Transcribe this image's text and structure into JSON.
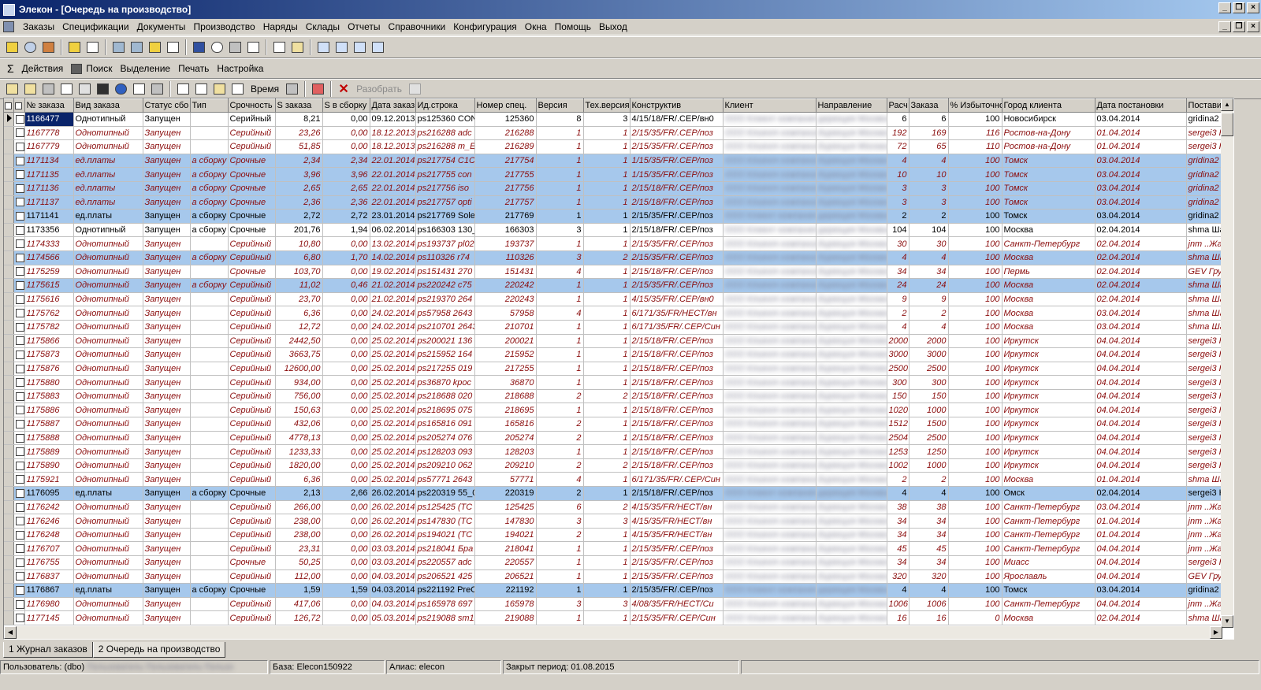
{
  "window": {
    "title": "Элекон - [Очередь на производство]"
  },
  "menu": [
    "Заказы",
    "Спецификации",
    "Документы",
    "Производство",
    "Наряды",
    "Склады",
    "Отчеты",
    "Справочники",
    "Конфигурация",
    "Окна",
    "Помощь",
    "Выход"
  ],
  "toolbar2": {
    "sigma": "Σ",
    "actions": "Действия",
    "search": "Поиск",
    "selection": "Выделение",
    "print": "Печать",
    "settings": "Настройка"
  },
  "toolbar3": {
    "time": "Время",
    "disassemble": "Разобрать"
  },
  "columns": [
    "№ заказа",
    "Вид заказа",
    "Статус сбо",
    "Тип",
    "Срочность",
    "S заказа",
    "S в сборку",
    "Дата заказ",
    "Ид.строка",
    "Номер спец.",
    "Версия",
    "Тех.версия",
    "Конструктив",
    "Клиент",
    "Направление",
    "Расч",
    "Заказа",
    "% Избыточно",
    "Город клиента",
    "Дата постановки",
    "Постави"
  ],
  "rows": [
    {
      "s": "cur",
      "c": [
        "1166477",
        "Однотипный",
        "Запущен",
        "",
        "Серийный",
        "8,21",
        "0,00",
        "09.12.2013",
        "ps125360 CON",
        "125360",
        "8",
        "3",
        "4/15/18/FR/.CEP/вн0",
        "",
        "",
        "6",
        "6",
        "100",
        "Новосибирск",
        "03.04.2014",
        "gridina2 I"
      ]
    },
    {
      "s": "it",
      "c": [
        "1167778",
        "Однотипный",
        "Запущен",
        "",
        "Серийный",
        "23,26",
        "0,00",
        "18.12.2013",
        "ps216288 adc",
        "216288",
        "1",
        "1",
        "2/15/35/FR/.CEP/поз",
        "",
        "",
        "192",
        "169",
        "116",
        "Ростов-на-Дону",
        "01.04.2014",
        "sergei3 H"
      ]
    },
    {
      "s": "it",
      "c": [
        "1167779",
        "Однотипный",
        "Запущен",
        "",
        "Серийный",
        "51,85",
        "0,00",
        "18.12.2013",
        "ps216288 m_E",
        "216289",
        "1",
        "1",
        "2/15/35/FR/.CEP/поз",
        "",
        "",
        "72",
        "65",
        "110",
        "Ростов-на-Дону",
        "01.04.2014",
        "sergei3 H"
      ]
    },
    {
      "s": "hl it",
      "c": [
        "1171134",
        "ед.платы",
        "Запущен",
        "а сборку",
        "Срочные",
        "2,34",
        "2,34",
        "22.01.2014",
        "ps217754 C1C",
        "217754",
        "1",
        "1",
        "1/15/35/FR/.CEP/поз",
        "",
        "",
        "4",
        "4",
        "100",
        "Томск",
        "03.04.2014",
        "gridina2 I"
      ]
    },
    {
      "s": "hl it",
      "c": [
        "1171135",
        "ед.платы",
        "Запущен",
        "а сборку",
        "Срочные",
        "3,96",
        "3,96",
        "22.01.2014",
        "ps217755 con",
        "217755",
        "1",
        "1",
        "1/15/35/FR/.CEP/поз",
        "",
        "",
        "10",
        "10",
        "100",
        "Томск",
        "03.04.2014",
        "gridina2 I"
      ]
    },
    {
      "s": "hl it",
      "c": [
        "1171136",
        "ед.платы",
        "Запущен",
        "а сборку",
        "Срочные",
        "2,65",
        "2,65",
        "22.01.2014",
        "ps217756 iso",
        "217756",
        "1",
        "1",
        "2/15/18/FR/.CEP/поз",
        "",
        "",
        "3",
        "3",
        "100",
        "Томск",
        "03.04.2014",
        "gridina2 I"
      ]
    },
    {
      "s": "hl it",
      "c": [
        "1171137",
        "ед.платы",
        "Запущен",
        "а сборку",
        "Срочные",
        "2,36",
        "2,36",
        "22.01.2014",
        "ps217757 opti",
        "217757",
        "1",
        "1",
        "2/15/18/FR/.CEP/поз",
        "",
        "",
        "3",
        "3",
        "100",
        "Томск",
        "03.04.2014",
        "gridina2 I"
      ]
    },
    {
      "s": "hl",
      "c": [
        "1171141",
        "ед.платы",
        "Запущен",
        "а сборку",
        "Срочные",
        "2,72",
        "2,72",
        "23.01.2014",
        "ps217769 Sole",
        "217769",
        "1",
        "1",
        "2/15/35/FR/.CEP/поз",
        "",
        "",
        "2",
        "2",
        "100",
        "Томск",
        "03.04.2014",
        "gridina2 I"
      ]
    },
    {
      "s": "",
      "c": [
        "1173356",
        "Однотипный",
        "Запущен",
        "а сборку",
        "Срочные",
        "201,76",
        "1,94",
        "06.02.2014",
        "ps166303 130_",
        "166303",
        "3",
        "1",
        "2/15/18/FR/.CEP/поз",
        "",
        "",
        "104",
        "104",
        "100",
        "Москва",
        "02.04.2014",
        "shma Ша"
      ]
    },
    {
      "s": "it",
      "c": [
        "1174333",
        "Однотипный",
        "Запущен",
        "",
        "Серийный",
        "10,80",
        "0,00",
        "13.02.2014",
        "ps193737 pl02",
        "193737",
        "1",
        "1",
        "2/15/35/FR/.CEP/поз",
        "",
        "",
        "30",
        "30",
        "100",
        "Санкт-Петербург",
        "02.04.2014",
        "jnm ..Жа"
      ]
    },
    {
      "s": "hl it",
      "c": [
        "1174566",
        "Однотипный",
        "Запущен",
        "а сборку",
        "Серийный",
        "6,80",
        "1,70",
        "14.02.2014",
        "ps110326 r74",
        "110326",
        "3",
        "2",
        "2/15/35/FR/.CEP/поз",
        "",
        "",
        "4",
        "4",
        "100",
        "Москва",
        "02.04.2014",
        "shma Ша"
      ]
    },
    {
      "s": "it",
      "c": [
        "1175259",
        "Однотипный",
        "Запущен",
        "",
        "Срочные",
        "103,70",
        "0,00",
        "19.02.2014",
        "ps151431 270",
        "151431",
        "4",
        "1",
        "2/15/18/FR/.CEP/поз",
        "",
        "",
        "34",
        "34",
        "100",
        "Пермь",
        "02.04.2014",
        "GEV Гру"
      ]
    },
    {
      "s": "hl it",
      "c": [
        "1175615",
        "Однотипный",
        "Запущен",
        "а сборку",
        "Серийный",
        "11,02",
        "0,46",
        "21.02.2014",
        "ps220242 c75",
        "220242",
        "1",
        "1",
        "2/15/35/FR/.CEP/поз",
        "",
        "",
        "24",
        "24",
        "100",
        "Москва",
        "02.04.2014",
        "shma Ша"
      ]
    },
    {
      "s": "it",
      "c": [
        "1175616",
        "Однотипный",
        "Запущен",
        "",
        "Серийный",
        "23,70",
        "0,00",
        "21.02.2014",
        "ps219370 264",
        "220243",
        "1",
        "1",
        "4/15/35/FR/.CEP/вн0",
        "",
        "",
        "9",
        "9",
        "100",
        "Москва",
        "02.04.2014",
        "shma Ша"
      ]
    },
    {
      "s": "it",
      "c": [
        "1175762",
        "Однотипный",
        "Запущен",
        "",
        "Серийный",
        "6,36",
        "0,00",
        "24.02.2014",
        "ps57958 2643",
        "57958",
        "4",
        "1",
        "6/171/35/FR/НЕСТ/вн",
        "",
        "",
        "2",
        "2",
        "100",
        "Москва",
        "03.04.2014",
        "shma Ша"
      ]
    },
    {
      "s": "it",
      "c": [
        "1175782",
        "Однотипный",
        "Запущен",
        "",
        "Серийный",
        "12,72",
        "0,00",
        "24.02.2014",
        "ps210701 2643",
        "210701",
        "1",
        "1",
        "6/171/35/FR/.CEP/Син",
        "",
        "",
        "4",
        "4",
        "100",
        "Москва",
        "03.04.2014",
        "shma Ша"
      ]
    },
    {
      "s": "it",
      "c": [
        "1175866",
        "Однотипный",
        "Запущен",
        "",
        "Серийный",
        "2442,50",
        "0,00",
        "25.02.2014",
        "ps200021 136",
        "200021",
        "1",
        "1",
        "2/15/18/FR/.CEP/поз",
        "",
        "",
        "2000",
        "2000",
        "100",
        "Иркутск",
        "04.04.2014",
        "sergei3 H"
      ]
    },
    {
      "s": "it",
      "c": [
        "1175873",
        "Однотипный",
        "Запущен",
        "",
        "Серийный",
        "3663,75",
        "0,00",
        "25.02.2014",
        "ps215952 164",
        "215952",
        "1",
        "1",
        "2/15/18/FR/.CEP/поз",
        "",
        "",
        "3000",
        "3000",
        "100",
        "Иркутск",
        "04.04.2014",
        "sergei3 H"
      ]
    },
    {
      "s": "it",
      "c": [
        "1175876",
        "Однотипный",
        "Запущен",
        "",
        "Серийный",
        "12600,00",
        "0,00",
        "25.02.2014",
        "ps217255 019",
        "217255",
        "1",
        "1",
        "2/15/18/FR/.CEP/поз",
        "",
        "",
        "2500",
        "2500",
        "100",
        "Иркутск",
        "04.04.2014",
        "sergei3 H"
      ]
    },
    {
      "s": "it",
      "c": [
        "1175880",
        "Однотипный",
        "Запущен",
        "",
        "Серийный",
        "934,00",
        "0,00",
        "25.02.2014",
        "ps36870 kpoc",
        "36870",
        "1",
        "1",
        "2/15/18/FR/.CEP/поз",
        "",
        "",
        "300",
        "300",
        "100",
        "Иркутск",
        "04.04.2014",
        "sergei3 H"
      ]
    },
    {
      "s": "it",
      "c": [
        "1175883",
        "Однотипный",
        "Запущен",
        "",
        "Серийный",
        "756,00",
        "0,00",
        "25.02.2014",
        "ps218688 020",
        "218688",
        "2",
        "2",
        "2/15/18/FR/.CEP/поз",
        "",
        "",
        "150",
        "150",
        "100",
        "Иркутск",
        "04.04.2014",
        "sergei3 H"
      ]
    },
    {
      "s": "it",
      "c": [
        "1175886",
        "Однотипный",
        "Запущен",
        "",
        "Серийный",
        "150,63",
        "0,00",
        "25.02.2014",
        "ps218695 075",
        "218695",
        "1",
        "1",
        "2/15/18/FR/.CEP/поз",
        "",
        "",
        "1020",
        "1000",
        "100",
        "Иркутск",
        "04.04.2014",
        "sergei3 H"
      ]
    },
    {
      "s": "it",
      "c": [
        "1175887",
        "Однотипный",
        "Запущен",
        "",
        "Серийный",
        "432,06",
        "0,00",
        "25.02.2014",
        "ps165816 091",
        "165816",
        "2",
        "1",
        "2/15/18/FR/.CEP/поз",
        "",
        "",
        "1512",
        "1500",
        "100",
        "Иркутск",
        "04.04.2014",
        "sergei3 H"
      ]
    },
    {
      "s": "it",
      "c": [
        "1175888",
        "Однотипный",
        "Запущен",
        "",
        "Серийный",
        "4778,13",
        "0,00",
        "25.02.2014",
        "ps205274 076",
        "205274",
        "2",
        "1",
        "2/15/18/FR/.CEP/поз",
        "",
        "",
        "2504",
        "2500",
        "100",
        "Иркутск",
        "04.04.2014",
        "sergei3 H"
      ]
    },
    {
      "s": "it",
      "c": [
        "1175889",
        "Однотипный",
        "Запущен",
        "",
        "Серийный",
        "1233,33",
        "0,00",
        "25.02.2014",
        "ps128203 093",
        "128203",
        "1",
        "1",
        "2/15/18/FR/.CEP/поз",
        "",
        "",
        "1253",
        "1250",
        "100",
        "Иркутск",
        "04.04.2014",
        "sergei3 H"
      ]
    },
    {
      "s": "it",
      "c": [
        "1175890",
        "Однотипный",
        "Запущен",
        "",
        "Серийный",
        "1820,00",
        "0,00",
        "25.02.2014",
        "ps209210 062",
        "209210",
        "2",
        "2",
        "2/15/18/FR/.CEP/поз",
        "",
        "",
        "1002",
        "1000",
        "100",
        "Иркутск",
        "04.04.2014",
        "sergei3 H"
      ]
    },
    {
      "s": "it",
      "c": [
        "1175921",
        "Однотипный",
        "Запущен",
        "",
        "Серийный",
        "6,36",
        "0,00",
        "25.02.2014",
        "ps57771 2643",
        "57771",
        "4",
        "1",
        "6/171/35/FR/.CEP/Син",
        "",
        "",
        "2",
        "2",
        "100",
        "Москва",
        "01.04.2014",
        "shma Ша"
      ]
    },
    {
      "s": "hl",
      "c": [
        "1176095",
        "ед.платы",
        "Запущен",
        "а сборку",
        "Срочные",
        "2,13",
        "2,66",
        "26.02.2014",
        "ps220319 55_0",
        "220319",
        "2",
        "1",
        "2/15/18/FR/.CEP/поз",
        "",
        "",
        "4",
        "4",
        "100",
        "Омск",
        "02.04.2014",
        "sergei3 H"
      ]
    },
    {
      "s": "it",
      "c": [
        "1176242",
        "Однотипный",
        "Запущен",
        "",
        "Серийный",
        "266,00",
        "0,00",
        "26.02.2014",
        "ps125425 (TC",
        "125425",
        "6",
        "2",
        "4/15/35/FR/НЕСТ/вн",
        "",
        "",
        "38",
        "38",
        "100",
        "Санкт-Петербург",
        "03.04.2014",
        "jnm ..Жа"
      ]
    },
    {
      "s": "it",
      "c": [
        "1176246",
        "Однотипный",
        "Запущен",
        "",
        "Серийный",
        "238,00",
        "0,00",
        "26.02.2014",
        "ps147830 (TC",
        "147830",
        "3",
        "3",
        "4/15/35/FR/НЕСТ/вн",
        "",
        "",
        "34",
        "34",
        "100",
        "Санкт-Петербург",
        "01.04.2014",
        "jnm ..Жа"
      ]
    },
    {
      "s": "it",
      "c": [
        "1176248",
        "Однотипный",
        "Запущен",
        "",
        "Серийный",
        "238,00",
        "0,00",
        "26.02.2014",
        "ps194021 (TC",
        "194021",
        "2",
        "1",
        "4/15/35/FR/НЕСТ/вн",
        "",
        "",
        "34",
        "34",
        "100",
        "Санкт-Петербург",
        "01.04.2014",
        "jnm ..Жа"
      ]
    },
    {
      "s": "it",
      "c": [
        "1176707",
        "Однотипный",
        "Запущен",
        "",
        "Серийный",
        "23,31",
        "0,00",
        "03.03.2014",
        "ps218041 Бра",
        "218041",
        "1",
        "1",
        "2/15/35/FR/.CEP/поз",
        "",
        "",
        "45",
        "45",
        "100",
        "Санкт-Петербург",
        "04.04.2014",
        "jnm ..Жа"
      ]
    },
    {
      "s": "it",
      "c": [
        "1176755",
        "Однотипный",
        "Запущен",
        "",
        "Срочные",
        "50,25",
        "0,00",
        "03.03.2014",
        "ps220557 adc",
        "220557",
        "1",
        "1",
        "2/15/35/FR/.CEP/поз",
        "",
        "",
        "34",
        "34",
        "100",
        "Миасс",
        "04.04.2014",
        "sergei3 H"
      ]
    },
    {
      "s": "it",
      "c": [
        "1176837",
        "Однотипный",
        "Запущен",
        "",
        "Серийный",
        "112,00",
        "0,00",
        "04.03.2014",
        "ps206521 425",
        "206521",
        "1",
        "1",
        "2/15/35/FR/.CEP/поз",
        "",
        "",
        "320",
        "320",
        "100",
        "Ярославль",
        "04.04.2014",
        "GEV Гру"
      ]
    },
    {
      "s": "hl",
      "c": [
        "1176867",
        "ед.платы",
        "Запущен",
        "а сборку",
        "Срочные",
        "1,59",
        "1,59",
        "04.03.2014",
        "ps221192 PreC",
        "221192",
        "1",
        "1",
        "2/15/35/FR/.CEP/поз",
        "",
        "",
        "4",
        "4",
        "100",
        "Томск",
        "03.04.2014",
        "gridina2 I"
      ]
    },
    {
      "s": "it",
      "c": [
        "1176980",
        "Однотипный",
        "Запущен",
        "",
        "Серийный",
        "417,06",
        "0,00",
        "04.03.2014",
        "ps165978 697",
        "165978",
        "3",
        "3",
        "4/08/35/FR/НЕСТ/Си",
        "",
        "",
        "1006",
        "1006",
        "100",
        "Санкт-Петербург",
        "04.04.2014",
        "jnm ..Жа"
      ]
    },
    {
      "s": "it",
      "c": [
        "1177145",
        "Однотипный",
        "Запущен",
        "",
        "Серийный",
        "126,72",
        "0,00",
        "05.03.2014",
        "ps219088 sm1",
        "219088",
        "1",
        "1",
        "2/15/35/FR/.CEP/Син",
        "",
        "",
        "16",
        "16",
        "0",
        "Москва",
        "02.04.2014",
        "shma Ша"
      ]
    }
  ],
  "tabs": [
    "1 Журнал заказов",
    "2 Очередь на производство"
  ],
  "status": {
    "user": "Пользователь: (dbo)",
    "base": "База: Elecon150922",
    "alias": "Алиас: elecon",
    "closed": "Закрыт период: 01.08.2015"
  }
}
